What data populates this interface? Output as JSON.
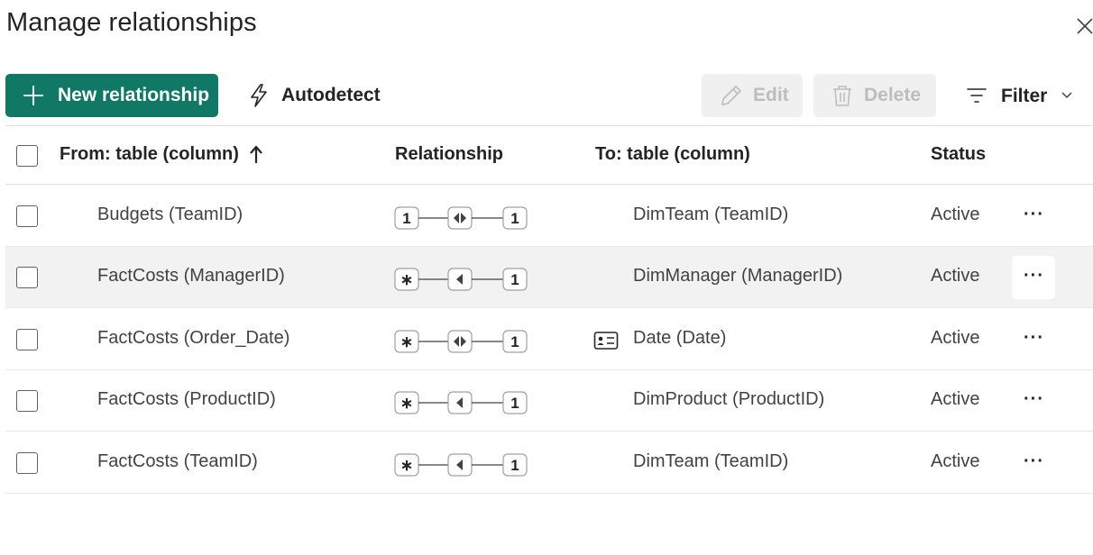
{
  "dialog": {
    "title": "Manage relationships",
    "close_icon": "close-icon"
  },
  "toolbar": {
    "new_relationship_label": "New relationship",
    "autodetect_label": "Autodetect",
    "edit_label": "Edit",
    "delete_label": "Delete",
    "filter_label": "Filter"
  },
  "colors": {
    "primary": "#117865",
    "disabled_bg": "#f0f0f0",
    "disabled_text": "#bdbdbd",
    "hover_row": "#f2f2f2"
  },
  "table": {
    "headers": {
      "from": "From: table (column)",
      "relationship": "Relationship",
      "to": "To: table (column)",
      "status": "Status"
    },
    "sorted_column": "from",
    "sort_direction": "ascending",
    "rows": [
      {
        "from": "Budgets (TeamID)",
        "from_cardinality": "1",
        "direction": "both",
        "to_cardinality": "1",
        "to": "DimTeam (TeamID)",
        "to_icon": "",
        "status": "Active",
        "more": "···"
      },
      {
        "from": "FactCosts (ManagerID)",
        "from_cardinality": "∗",
        "direction": "single",
        "to_cardinality": "1",
        "to": "DimManager (ManagerID)",
        "to_icon": "",
        "status": "Active",
        "more": "···"
      },
      {
        "from": "FactCosts (Order_Date)",
        "from_cardinality": "∗",
        "direction": "both",
        "to_cardinality": "1",
        "to": "Date (Date)",
        "to_icon": "date-table-icon",
        "status": "Active",
        "more": "···"
      },
      {
        "from": "FactCosts (ProductID)",
        "from_cardinality": "∗",
        "direction": "single",
        "to_cardinality": "1",
        "to": "DimProduct (ProductID)",
        "to_icon": "",
        "status": "Active",
        "more": "···"
      },
      {
        "from": "FactCosts (TeamID)",
        "from_cardinality": "∗",
        "direction": "single",
        "to_cardinality": "1",
        "to": "DimTeam (TeamID)",
        "to_icon": "",
        "status": "Active",
        "more": "···"
      }
    ]
  }
}
